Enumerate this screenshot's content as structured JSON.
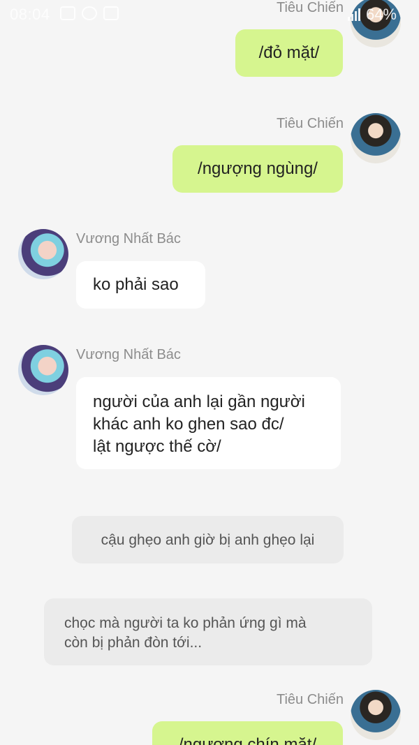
{
  "status_bar": {
    "time": "08:04",
    "battery": "64%",
    "icons": [
      "gallery-icon",
      "eye-icon",
      "message-icon",
      "signal-icon"
    ]
  },
  "messages": [
    {
      "sender": "Tiêu Chiến",
      "side": "right",
      "text": "/đỏ mặt/"
    },
    {
      "sender": "Tiêu Chiến",
      "side": "right",
      "text": "/ngượng ngùng/"
    },
    {
      "sender": "Vương Nhất Bác",
      "side": "left",
      "text": "ko phải sao"
    },
    {
      "sender": "Vương Nhất Bác",
      "side": "left",
      "lines": [
        "người của anh lại gần người",
        "khác anh ko ghen sao đc/",
        "lật ngược thế cờ/"
      ]
    },
    {
      "sender": "Tiêu Chiến",
      "side": "right",
      "text": "/ngượng chín mặt/"
    }
  ],
  "narration": [
    {
      "text": "cậu ghẹo anh giờ bị anh ghẹo lại"
    },
    {
      "lines": [
        "chọc mà người ta ko phản ứng gì mà",
        "còn bị phản đòn tới..."
      ]
    }
  ],
  "colors": {
    "background": "#f5f5f5",
    "my_bubble": "#d6f58f",
    "their_bubble": "#ffffff",
    "narration_bubble": "#ebebeb",
    "sender_name": "#8c8c8c"
  }
}
